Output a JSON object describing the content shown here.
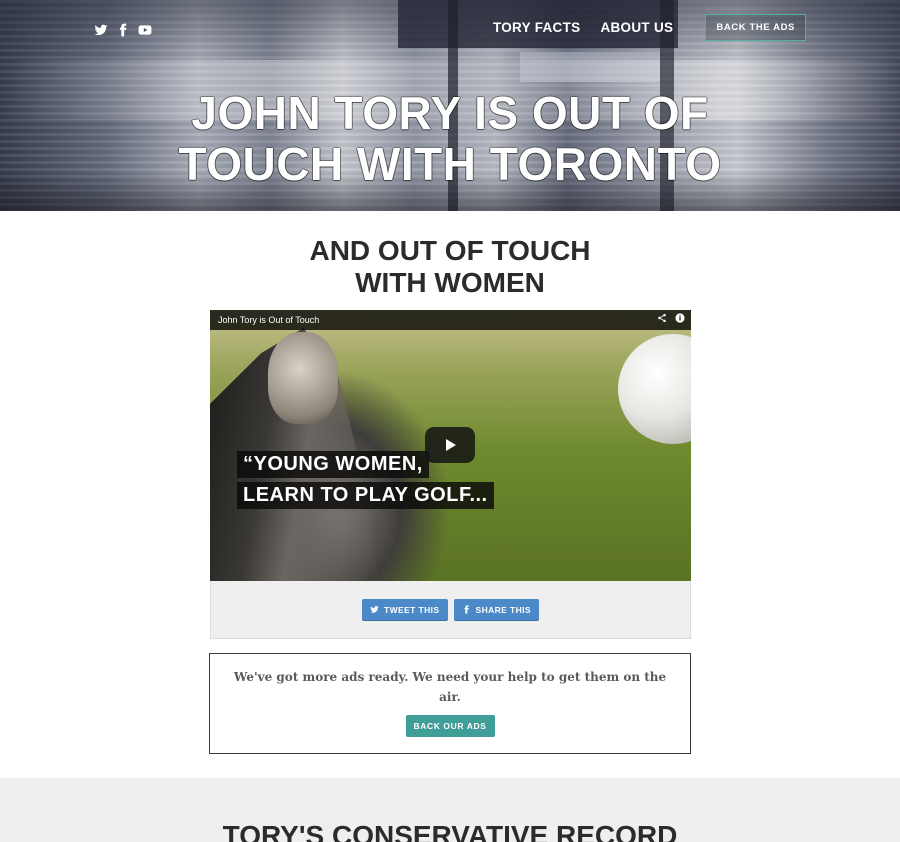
{
  "header": {
    "social_icons": [
      "twitter-icon",
      "facebook-icon",
      "youtube-icon"
    ],
    "nav": {
      "tory_facts": "TORY FACTS",
      "about_us": "ABOUT US",
      "back_the_ads": "BACK THE ADS"
    },
    "hero_title_line1": "JOHN TORY IS OUT OF",
    "hero_title_line2": "TOUCH WITH TORONTO"
  },
  "main": {
    "section_title_line1": "AND OUT OF TOUCH",
    "section_title_line2": "WITH WOMEN",
    "video": {
      "title": "John Tory is Out of Touch",
      "caption_line1": "“YOUNG WOMEN,",
      "caption_line2": "LEARN TO PLAY GOLF..."
    },
    "share": {
      "tweet_label": "TWEET THIS",
      "share_label": "SHARE THIS"
    },
    "cta": {
      "text": "We've got more ads ready. We need your help to get them on the air.",
      "button_label": "BACK OUR ADS"
    },
    "next_section_title": "TORY'S CONSERVATIVE RECORD"
  },
  "colors": {
    "accent_teal": "#3f9e98",
    "share_blue": "#4c89c8",
    "nav_border": "#4fb0a6"
  }
}
